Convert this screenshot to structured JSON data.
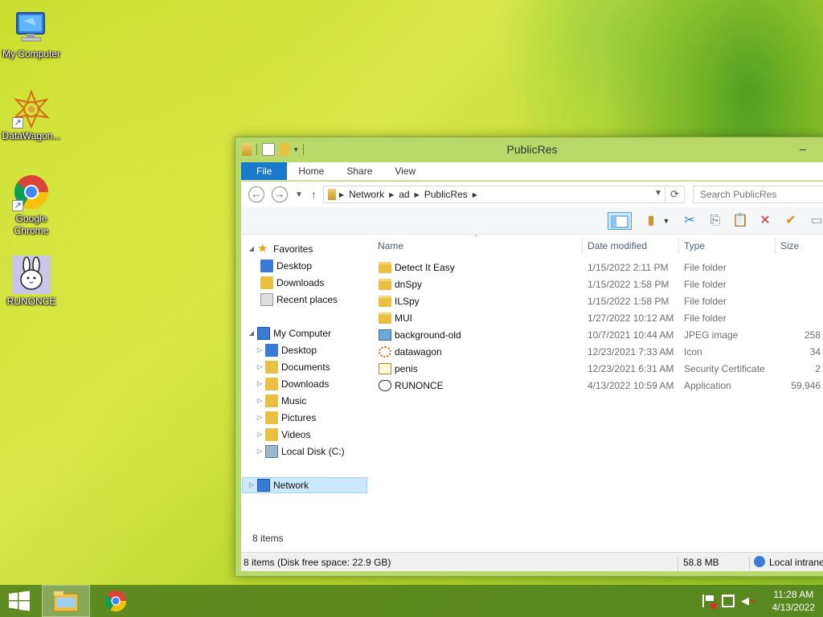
{
  "desktop": {
    "icons": [
      {
        "label": "My Computer"
      },
      {
        "label": "DataWagon..."
      },
      {
        "label": "Google Chrome"
      },
      {
        "label": "RUNONCE"
      }
    ]
  },
  "window": {
    "title": "PublicRes",
    "minimize_glyph": "–",
    "ribbon_tabs": [
      "File",
      "Home",
      "Share",
      "View"
    ],
    "address": {
      "crumbs": [
        "Network",
        "ad",
        "PublicRes"
      ],
      "search_placeholder": "Search PublicRes"
    },
    "nav": {
      "favorites_label": "Favorites",
      "favorites": [
        "Desktop",
        "Downloads",
        "Recent places"
      ],
      "computer_label": "My Computer",
      "computer": [
        "Desktop",
        "Documents",
        "Downloads",
        "Music",
        "Pictures",
        "Videos",
        "Local Disk (C:)"
      ],
      "network_label": "Network"
    },
    "columns": {
      "name": "Name",
      "date": "Date modified",
      "type": "Type",
      "size": "Size"
    },
    "files": [
      {
        "name": "Detect It Easy",
        "date": "1/15/2022 2:11 PM",
        "type": "File folder",
        "size": "",
        "icon": "folder-icon"
      },
      {
        "name": "dnSpy",
        "date": "1/15/2022 1:58 PM",
        "type": "File folder",
        "size": "",
        "icon": "folder-icon"
      },
      {
        "name": "ILSpy",
        "date": "1/15/2022 1:58 PM",
        "type": "File folder",
        "size": "",
        "icon": "folder-icon"
      },
      {
        "name": "MUI",
        "date": "1/27/2022 10:12 AM",
        "type": "File folder",
        "size": "",
        "icon": "folder-icon"
      },
      {
        "name": "background-old",
        "date": "10/7/2021 10:44 AM",
        "type": "JPEG image",
        "size": "258",
        "icon": "image-icon"
      },
      {
        "name": "datawagon",
        "date": "12/23/2021 7:33 AM",
        "type": "Icon",
        "size": "34",
        "icon": "ico-file-icon"
      },
      {
        "name": "penis",
        "date": "12/23/2021 6:31 AM",
        "type": "Security Certificate",
        "size": "2",
        "icon": "certificate-icon"
      },
      {
        "name": "RUNONCE",
        "date": "4/13/2022 10:59 AM",
        "type": "Application",
        "size": "59,946",
        "icon": "application-icon"
      }
    ],
    "item_count": "8 items",
    "status": {
      "left": "8 items (Disk free space: 22.9 GB)",
      "middle": "58.8 MB",
      "right": "Local intranet"
    }
  },
  "taskbar": {
    "clock_time": "11:28 AM",
    "clock_date": "4/13/2022"
  }
}
